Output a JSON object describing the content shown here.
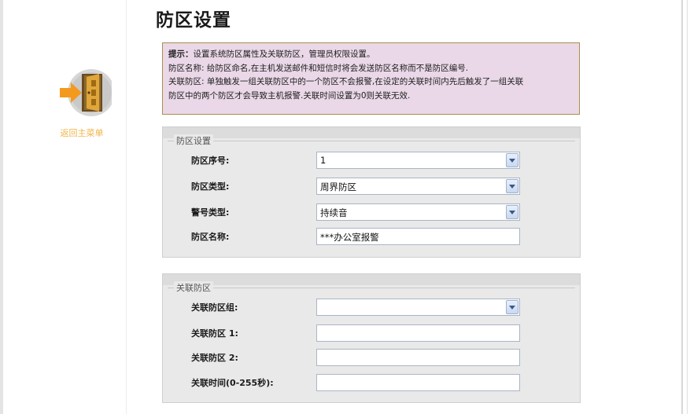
{
  "page": {
    "title": "防区设置"
  },
  "back": {
    "label": "返回主菜单",
    "icon": "exit-door-icon"
  },
  "tip": {
    "lead": "提示：",
    "line1": "设置系统防区属性及关联防区，管理员权限设置。",
    "line2": "防区名称: 给防区命名,在主机发送邮件和短信时将会发送防区名称而不是防区编号.",
    "line3": "关联防区: 单独触发一组关联防区中的一个防区不会报警,在设定的关联时间内先后触发了一组关联",
    "line4": "防区中的两个防区才会导致主机报警.关联时间设置为0则关联无效."
  },
  "zone_settings": {
    "legend": "防区设置",
    "zone_no": {
      "label": "防区序号:",
      "value": "1"
    },
    "zone_type": {
      "label": "防区类型:",
      "value": "周界防区"
    },
    "alarm_tone": {
      "label": "警号类型:",
      "value": "持续音"
    },
    "zone_name": {
      "label": "防区名称:",
      "value": "***办公室报警"
    }
  },
  "linked_zones": {
    "legend": "关联防区",
    "group": {
      "label": "关联防区组:",
      "value": ""
    },
    "zone1": {
      "label": "关联防区 1:",
      "value": ""
    },
    "zone2": {
      "label": "关联防区 2:",
      "value": ""
    },
    "time": {
      "label": "关联时间(0-255秒):",
      "value": ""
    }
  }
}
